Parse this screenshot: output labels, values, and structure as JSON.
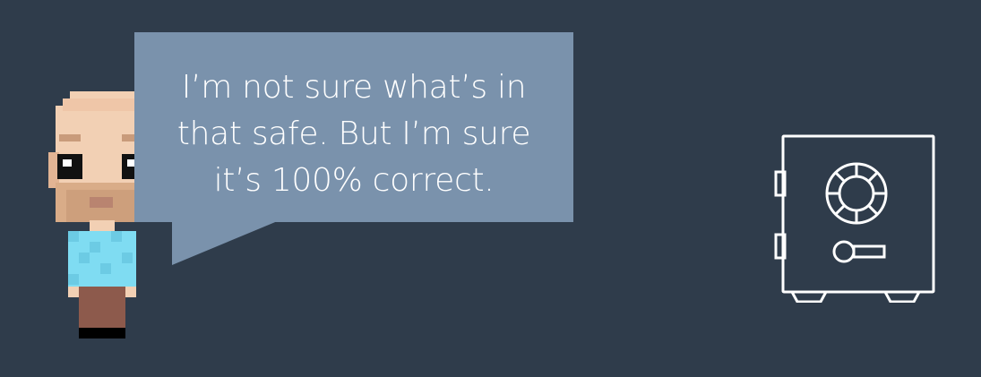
{
  "speech_bubble": {
    "lines": [
      "I’m not sure what’s in",
      "that safe. But I’m sure",
      "it’s 100% correct."
    ]
  },
  "colors": {
    "background": "#2f3c4b",
    "bubble": "#7a92ac",
    "bubble_text": "#ffffff",
    "safe_outline": "#ffffff",
    "skin": "#f2d0b4",
    "shirt": "#7fdcf2",
    "pants": "#8d5a4c",
    "shoes": "#000000"
  },
  "icons": {
    "character": "pixel-man-icon",
    "safe": "safe-icon"
  }
}
